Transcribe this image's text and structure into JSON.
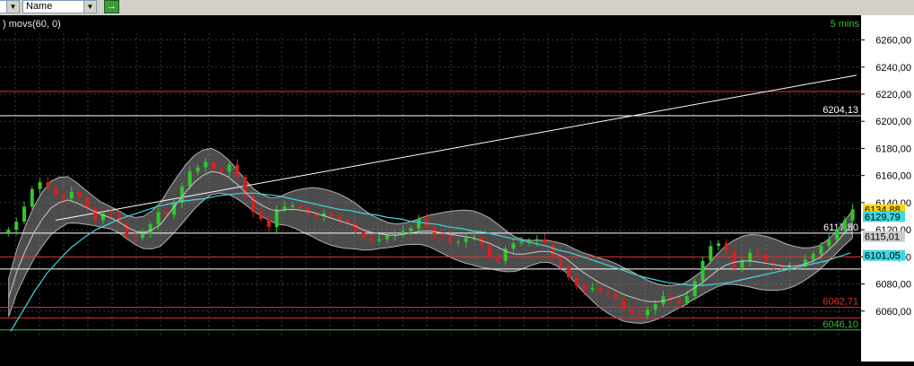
{
  "toolbar": {
    "symbol_dropdown": "",
    "name_dropdown": "Name",
    "go_button": "→"
  },
  "chart": {
    "indicator_label": ") movs(60, 0)",
    "timeframe": "5 mins",
    "colors": {
      "background": "#000000",
      "grid": "#3a3a3a",
      "up_candle": "#2ec82e",
      "down_candle": "#d42020",
      "band_fill": "#8a8a8a",
      "ma_short": "#c8c8c8",
      "ma_long": "#40d8e0",
      "axis_text": "#000000",
      "axis_bg": "#ffffff"
    }
  },
  "chart_data": {
    "type": "candlestick",
    "yaxis": {
      "ticks": [
        "6260,00",
        "6240,00",
        "6220,00",
        "6200,00",
        "6180,00",
        "6160,00",
        "6140,00",
        "6120,00",
        "6100,00",
        "6080,00",
        "6060,00"
      ],
      "ylim": [
        6040,
        6265
      ],
      "position": "right"
    },
    "grid": true,
    "horizontal_levels": [
      {
        "value": 6222,
        "color": "#e03030",
        "label": ""
      },
      {
        "value": 6204.13,
        "color": "#ffffff",
        "label": "6204,13"
      },
      {
        "value": 6117.5,
        "color": "#ffffff",
        "label": "6117,50"
      },
      {
        "value": 6100,
        "color": "#e03030",
        "label": ""
      },
      {
        "value": 6091,
        "color": "#ffffff",
        "label": ""
      },
      {
        "value": 6062.71,
        "color": "#e03030",
        "label": "6062,71"
      },
      {
        "value": 6055,
        "color": "#e03030",
        "label": ""
      },
      {
        "value": 6046.1,
        "color": "#30c030",
        "label": "6046,10"
      }
    ],
    "price_tags": [
      {
        "value": 6134.88,
        "label": "6134,88",
        "bg": "#ffd700",
        "color": "#000000"
      },
      {
        "value": 6129.79,
        "label": "6129,79",
        "bg": "#40d8e0",
        "color": "#000000"
      },
      {
        "value": 6115.01,
        "label": "6115,01",
        "bg": "#cccccc",
        "color": "#000000"
      },
      {
        "value": 6101.05,
        "label": "6101,05",
        "bg": "#40d8e0",
        "color": "#000000"
      }
    ],
    "trendline": {
      "from": [
        62,
        6127
      ],
      "to": [
        955,
        6234
      ]
    },
    "close_series": [
      6120,
      6126,
      6137,
      6150,
      6155,
      6151,
      6146,
      6143,
      6148,
      6144,
      6136,
      6127,
      6132,
      6131,
      6125,
      6115,
      6114,
      6117,
      6124,
      6133,
      6131,
      6140,
      6152,
      6163,
      6166,
      6170,
      6165,
      6163,
      6168,
      6159,
      6145,
      6133,
      6128,
      6122,
      6135,
      6137,
      6138,
      6136,
      6132,
      6130,
      6132,
      6130,
      6127,
      6125,
      6119,
      6114,
      6112,
      6113,
      6116,
      6116,
      6119,
      6121,
      6128,
      6122,
      6116,
      6115,
      6111,
      6111,
      6114,
      6114,
      6108,
      6100,
      6097,
      6106,
      6110,
      6111,
      6112,
      6113,
      6110,
      6099,
      6093,
      6085,
      6079,
      6076,
      6077,
      6074,
      6073,
      6069,
      6061,
      6058,
      6057,
      6061,
      6065,
      6071,
      6068,
      6066,
      6071,
      6082,
      6097,
      6108,
      6110,
      6104,
      6092,
      6097,
      6103,
      6102,
      6097,
      6094,
      6092,
      6094,
      6093,
      6098,
      6102,
      6108,
      6113,
      6120,
      6127,
      6135
    ],
    "ma_short_series": [
      6070,
      6090,
      6105,
      6118,
      6128,
      6136,
      6140,
      6142,
      6140,
      6137,
      6134,
      6131,
      6129,
      6126,
      6122,
      6119,
      6118,
      6120,
      6124,
      6132,
      6140,
      6148,
      6155,
      6160,
      6163,
      6162,
      6159,
      6154,
      6148,
      6142,
      6138,
      6135,
      6134,
      6135,
      6135,
      6134,
      6133,
      6131,
      6129,
      6127,
      6125,
      6123,
      6120,
      6118,
      6117,
      6116,
      6116,
      6117,
      6118,
      6119,
      6119,
      6118,
      6117,
      6116,
      6115,
      6114,
      6112,
      6110,
      6107,
      6104,
      6102,
      6102,
      6103,
      6104,
      6104,
      6102,
      6099,
      6094,
      6089,
      6085,
      6081,
      6078,
      6075,
      6072,
      6070,
      6068,
      6067,
      6067,
      6068,
      6070,
      6072,
      6076,
      6080,
      6085,
      6090,
      6094,
      6096,
      6097,
      6097,
      6096,
      6095,
      6094,
      6093,
      6093,
      6094,
      6096,
      6099,
      6104,
      6110,
      6117,
      6124
    ],
    "ma_long_series": [
      6045,
      6060,
      6075,
      6088,
      6098,
      6107,
      6114,
      6120,
      6124,
      6128,
      6131,
      6134,
      6137,
      6139,
      6141,
      6142,
      6143,
      6145,
      6146,
      6147,
      6147,
      6146,
      6145,
      6143,
      6141,
      6139,
      6137,
      6135,
      6134,
      6132,
      6131,
      6129,
      6128,
      6126,
      6125,
      6124,
      6122,
      6121,
      6119,
      6118,
      6116,
      6114,
      6112,
      6110,
      6108,
      6105,
      6103,
      6100,
      6097,
      6094,
      6091,
      6088,
      6085,
      6083,
      6081,
      6080,
      6079,
      6079,
      6080,
      6081,
      6083,
      6085,
      6087,
      6089,
      6091,
      6093,
      6095,
      6097,
      6100,
      6103
    ]
  }
}
